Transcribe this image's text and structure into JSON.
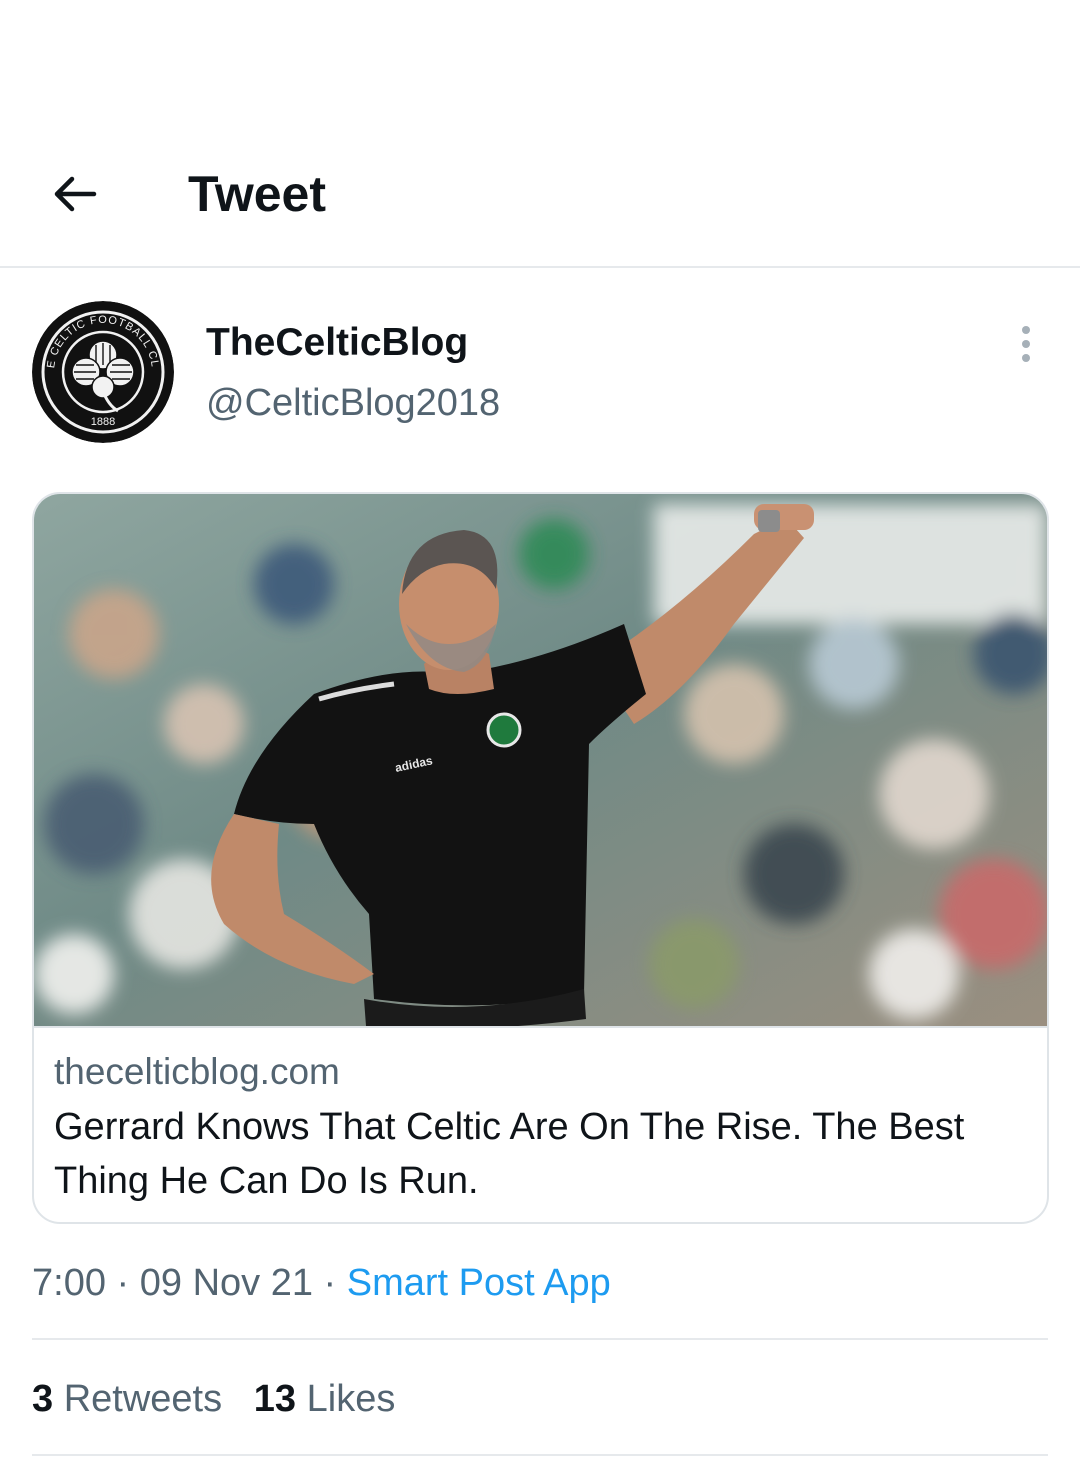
{
  "header": {
    "title": "Tweet",
    "back_icon": "arrow-left-icon"
  },
  "author": {
    "name": "TheCelticBlog",
    "handle": "@CelticBlog2018",
    "avatar_text_top": "THE CELTIC FOOTBALL CLUB",
    "avatar_year": "1888"
  },
  "more_icon": "vertical-ellipsis-icon",
  "card": {
    "domain": "thecelticblog.com",
    "title": "Gerrard Knows That Celtic Are On The Rise. The Best Thing He Can Do Is Run.",
    "shirt_text": "adidas"
  },
  "meta": {
    "time": "7:00",
    "separator": " · ",
    "date": "09 Nov 21",
    "source": "Smart Post App"
  },
  "stats": {
    "retweets_count": "3",
    "retweets_label": "Retweets",
    "likes_count": "13",
    "likes_label": "Likes"
  },
  "colors": {
    "text_primary": "#0f1419",
    "text_secondary": "#536471",
    "link_blue": "#1d9bf0",
    "divider": "#e6e9ec"
  }
}
